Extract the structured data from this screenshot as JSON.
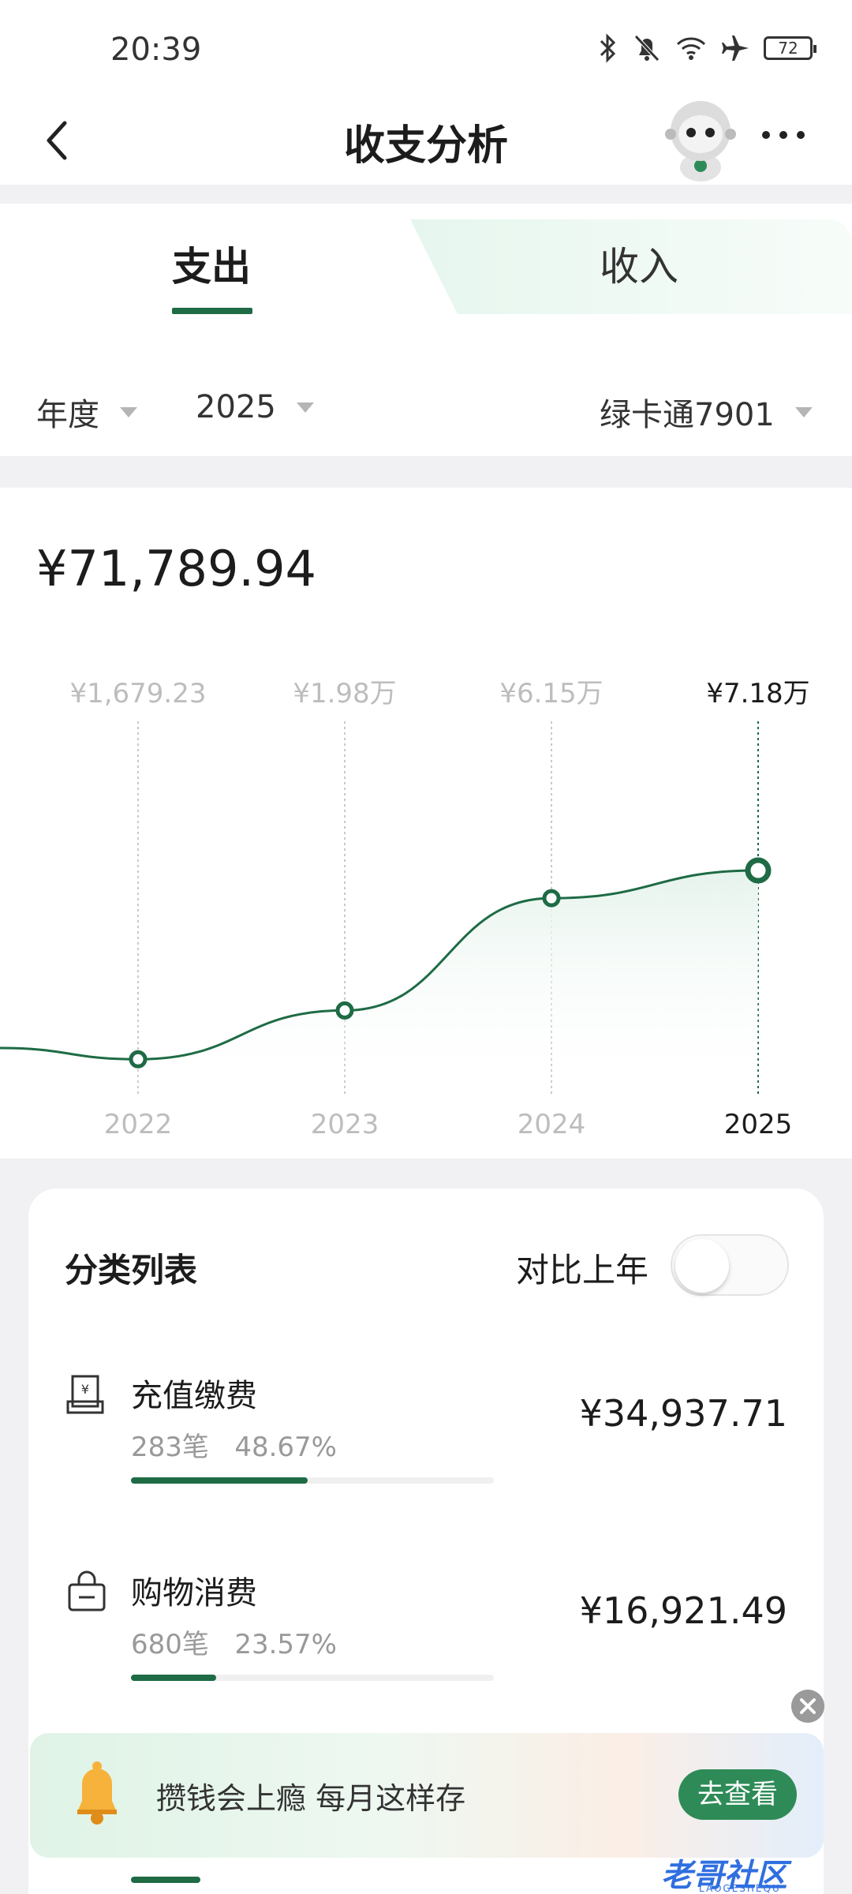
{
  "status_bar": {
    "time": "20:39",
    "battery": "72"
  },
  "header": {
    "title": "收支分析"
  },
  "tabs": {
    "expense": "支出",
    "income": "收入",
    "active": "支出"
  },
  "filters": {
    "period": "年度",
    "year": "2025",
    "account": "绿卡通7901"
  },
  "summary": {
    "total": "¥71,789.94"
  },
  "chart_data": {
    "type": "area",
    "x": [
      "2022",
      "2023",
      "2024",
      "2025"
    ],
    "point_labels": [
      "¥1,679.23",
      "¥1.98万",
      "¥6.15万",
      "¥7.18万"
    ],
    "values": [
      1679.23,
      19800,
      61500,
      71800
    ],
    "selected": "2025",
    "colors": {
      "line": "#1e6b45",
      "fill": "#e6f3ec"
    }
  },
  "category_list": {
    "title": "分类列表",
    "compare_label": "对比上年",
    "compare_on": false,
    "items": [
      {
        "icon": "receipt-yen-icon",
        "name": "充值缴费",
        "count": "283笔",
        "percent": "48.67%",
        "share": 0.4867,
        "amount": "¥34,937.71"
      },
      {
        "icon": "shopping-bag-icon",
        "name": "购物消费",
        "count": "680笔",
        "percent": "23.57%",
        "share": 0.2357,
        "amount": "¥16,921.49"
      }
    ]
  },
  "ad": {
    "text": "攒钱会上瘾 每月这样存",
    "button": "去查看"
  },
  "watermark": {
    "text": "老哥社区",
    "sub": "LAOGESHEQU"
  },
  "colors": {
    "accent": "#1e6b45"
  }
}
